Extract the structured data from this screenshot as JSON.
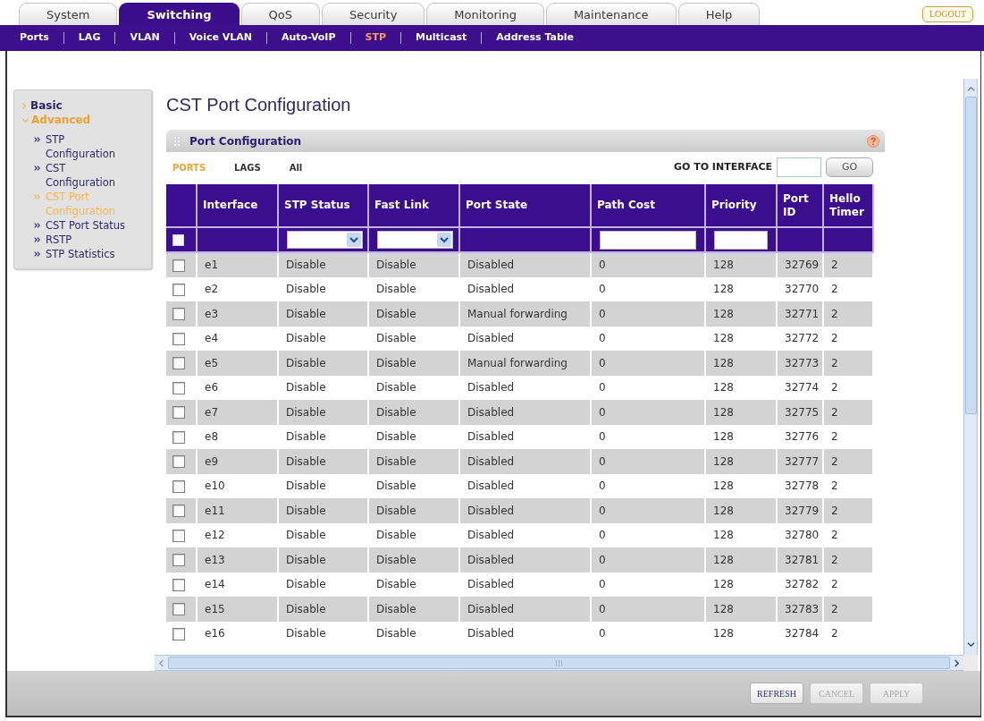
{
  "nav_tabs": [
    {
      "label": "System",
      "selected": false
    },
    {
      "label": "Switching",
      "selected": true
    },
    {
      "label": "QoS",
      "selected": false
    },
    {
      "label": "Security",
      "selected": false
    },
    {
      "label": "Monitoring",
      "selected": false
    },
    {
      "label": "Maintenance",
      "selected": false
    },
    {
      "label": "Help",
      "selected": false
    }
  ],
  "logout_button": "LOGOUT",
  "sub_nav": [
    {
      "label": "Ports",
      "selected": false
    },
    {
      "label": "LAG",
      "selected": false
    },
    {
      "label": "VLAN",
      "selected": false
    },
    {
      "label": "Voice VLAN",
      "selected": false
    },
    {
      "label": "Auto-VoIP",
      "selected": false
    },
    {
      "label": "STP",
      "selected": true
    },
    {
      "label": "Multicast",
      "selected": false
    },
    {
      "label": "Address Table",
      "selected": false
    }
  ],
  "sidebar": {
    "items": [
      {
        "label": "Basic",
        "expanded": false,
        "selected": false
      },
      {
        "label": "Advanced",
        "expanded": true,
        "selected": true,
        "children": [
          {
            "label": "STP Configuration",
            "selected": false
          },
          {
            "label": "CST Configuration",
            "selected": false
          },
          {
            "label": "CST Port Configuration",
            "selected": true
          },
          {
            "label": "CST Port Status",
            "selected": false
          },
          {
            "label": "RSTP",
            "selected": false
          },
          {
            "label": "STP Statistics",
            "selected": false
          }
        ]
      }
    ]
  },
  "page_title": "CST Port Configuration",
  "panel": {
    "title": "Port Configuration",
    "filter_tabs": [
      {
        "label": "PORTS",
        "selected": true
      },
      {
        "label": "LAGS",
        "selected": false
      },
      {
        "label": "All",
        "selected": false
      }
    ],
    "go_to_interface": {
      "label": "GO TO INTERFACE",
      "button": "GO"
    },
    "table": {
      "columns": [
        {
          "label": "Interface"
        },
        {
          "label": "STP Status"
        },
        {
          "label": "Fast Link"
        },
        {
          "label": "Port State"
        },
        {
          "label": "Path Cost"
        },
        {
          "label": "Priority"
        },
        {
          "label": "Port ID"
        },
        {
          "label": "Hello Timer"
        }
      ],
      "filter_row": {
        "select_all": {
          "checked": false
        },
        "cells": [
          {
            "kind": "blank"
          },
          {
            "kind": "select"
          },
          {
            "kind": "select"
          },
          {
            "kind": "blank"
          },
          {
            "kind": "input"
          },
          {
            "kind": "input"
          },
          {
            "kind": "blank"
          },
          {
            "kind": "blank"
          }
        ]
      },
      "rows": [
        {
          "checked": false,
          "cells": [
            "e1",
            "Disable",
            "Disable",
            "Disabled",
            "0",
            "128",
            "32769",
            "2"
          ]
        },
        {
          "checked": false,
          "cells": [
            "e2",
            "Disable",
            "Disable",
            "Disabled",
            "0",
            "128",
            "32770",
            "2"
          ]
        },
        {
          "checked": false,
          "cells": [
            "e3",
            "Disable",
            "Disable",
            "Manual forwarding",
            "0",
            "128",
            "32771",
            "2"
          ]
        },
        {
          "checked": false,
          "cells": [
            "e4",
            "Disable",
            "Disable",
            "Disabled",
            "0",
            "128",
            "32772",
            "2"
          ]
        },
        {
          "checked": false,
          "cells": [
            "e5",
            "Disable",
            "Disable",
            "Manual forwarding",
            "0",
            "128",
            "32773",
            "2"
          ]
        },
        {
          "checked": false,
          "cells": [
            "e6",
            "Disable",
            "Disable",
            "Disabled",
            "0",
            "128",
            "32774",
            "2"
          ]
        },
        {
          "checked": false,
          "cells": [
            "e7",
            "Disable",
            "Disable",
            "Disabled",
            "0",
            "128",
            "32775",
            "2"
          ]
        },
        {
          "checked": false,
          "cells": [
            "e8",
            "Disable",
            "Disable",
            "Disabled",
            "0",
            "128",
            "32776",
            "2"
          ]
        },
        {
          "checked": false,
          "cells": [
            "e9",
            "Disable",
            "Disable",
            "Disabled",
            "0",
            "128",
            "32777",
            "2"
          ]
        },
        {
          "checked": false,
          "cells": [
            "e10",
            "Disable",
            "Disable",
            "Disabled",
            "0",
            "128",
            "32778",
            "2"
          ]
        },
        {
          "checked": false,
          "cells": [
            "e11",
            "Disable",
            "Disable",
            "Disabled",
            "0",
            "128",
            "32779",
            "2"
          ]
        },
        {
          "checked": false,
          "cells": [
            "e12",
            "Disable",
            "Disable",
            "Disabled",
            "0",
            "128",
            "32780",
            "2"
          ]
        },
        {
          "checked": false,
          "cells": [
            "e13",
            "Disable",
            "Disable",
            "Disabled",
            "0",
            "128",
            "32781",
            "2"
          ]
        },
        {
          "checked": false,
          "cells": [
            "e14",
            "Disable",
            "Disable",
            "Disabled",
            "0",
            "128",
            "32782",
            "2"
          ]
        },
        {
          "checked": false,
          "cells": [
            "e15",
            "Disable",
            "Disable",
            "Disabled",
            "0",
            "128",
            "32783",
            "2"
          ]
        },
        {
          "checked": false,
          "cells": [
            "e16",
            "Disable",
            "Disable",
            "Disabled",
            "0",
            "128",
            "32784",
            "2"
          ]
        }
      ]
    }
  },
  "buttons": [
    {
      "label": "REFRESH",
      "disabled": false
    },
    {
      "label": "CANCEL",
      "disabled": true
    },
    {
      "label": "APPLY",
      "disabled": true
    }
  ]
}
